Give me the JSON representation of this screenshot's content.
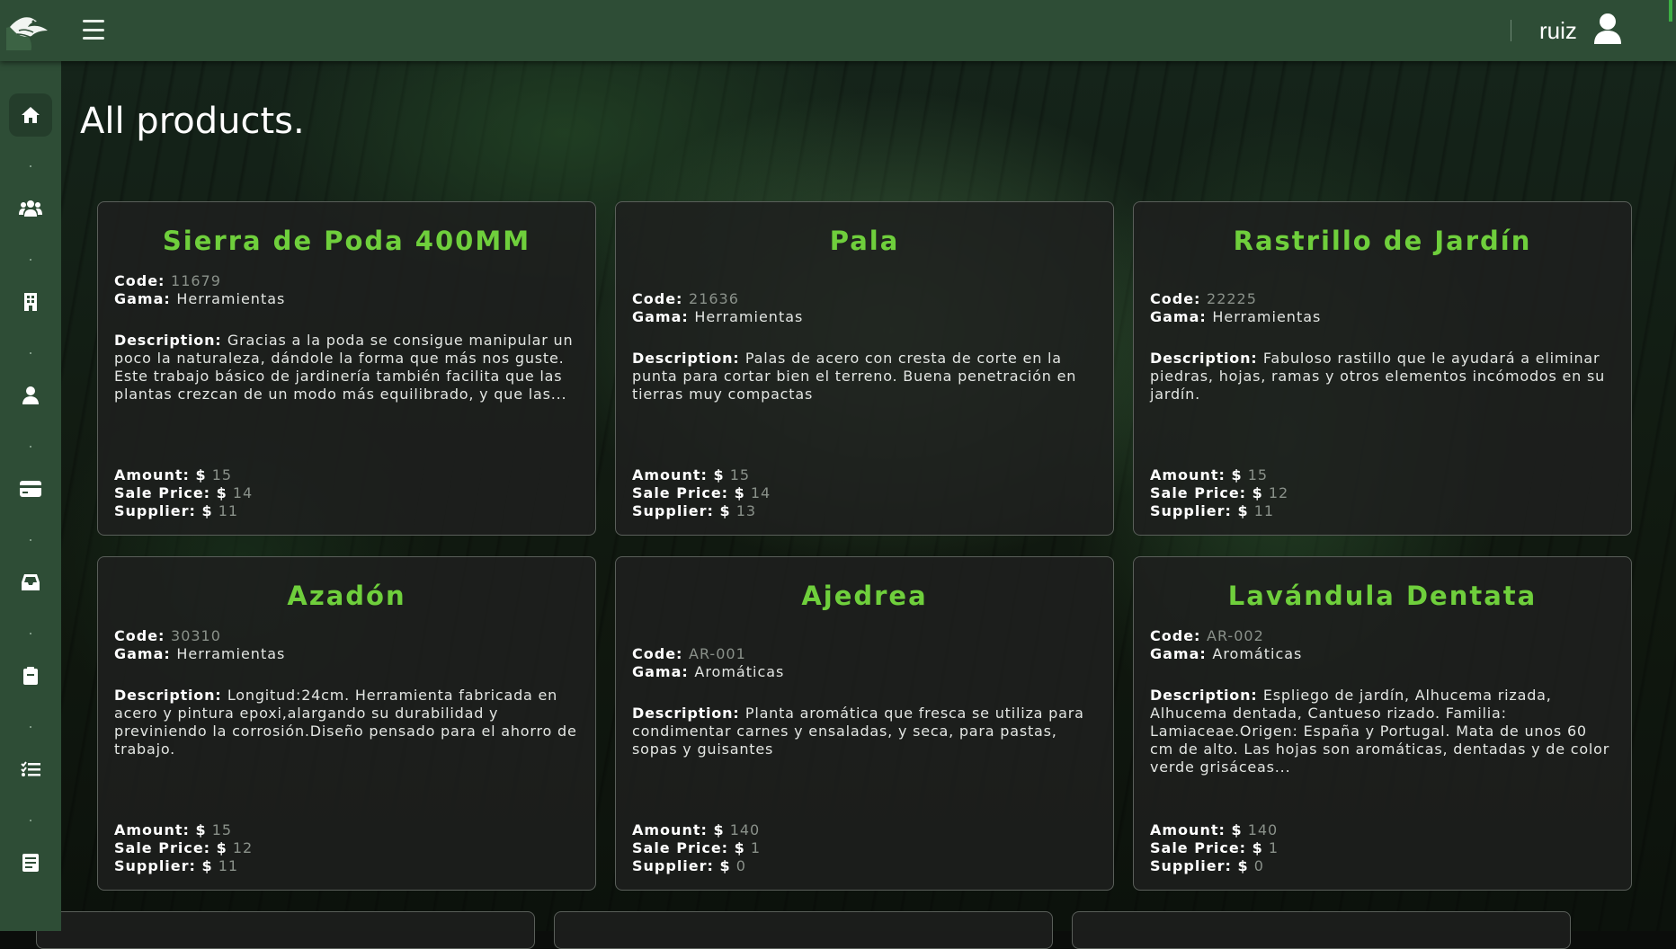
{
  "header": {
    "menu_label": "",
    "user_name": "ruiz"
  },
  "sidebar": {
    "items": [
      {
        "icon": "home-icon",
        "active": true
      },
      {
        "icon": "users-icon",
        "active": false
      },
      {
        "icon": "building-icon",
        "active": false
      },
      {
        "icon": "user-icon",
        "active": false
      },
      {
        "icon": "credit-card-icon",
        "active": false
      },
      {
        "icon": "inbox-icon",
        "active": false
      },
      {
        "icon": "clipboard-icon",
        "active": false
      },
      {
        "icon": "tasks-list-icon",
        "active": false
      },
      {
        "icon": "document-icon",
        "active": false
      }
    ]
  },
  "page": {
    "title": "All products."
  },
  "labels": {
    "code": "Code",
    "gama": "Gama",
    "description": "Description",
    "amount": "Amount",
    "sale_price": "Sale Price",
    "supplier": "Supplier",
    "currency": "$"
  },
  "products": [
    {
      "name": "Sierra de Poda 400MM",
      "code": "11679",
      "gama": "Herramientas",
      "description": "Gracias a la poda se consigue manipular un poco la naturaleza, dándole la forma que más nos guste. Este trabajo básico de jardinería también facilita que las plantas crezcan de un modo más equilibrado, y que las...",
      "amount": "15",
      "sale_price": "14",
      "supplier": "11"
    },
    {
      "name": "Pala",
      "code": "21636",
      "gama": "Herramientas",
      "description": "Palas de acero con cresta de corte en la punta para cortar bien el terreno. Buena penetración en tierras muy compactas",
      "amount": "15",
      "sale_price": "14",
      "supplier": "13"
    },
    {
      "name": "Rastrillo de Jardín",
      "code": "22225",
      "gama": "Herramientas",
      "description": "Fabuloso rastillo que le ayudará a eliminar piedras, hojas, ramas y otros elementos incómodos en su jardín.",
      "amount": "15",
      "sale_price": "12",
      "supplier": "11"
    },
    {
      "name": "Azadón",
      "code": "30310",
      "gama": "Herramientas",
      "description": "Longitud:24cm. Herramienta fabricada en acero y pintura epoxi,alargando su durabilidad y previniendo la corrosión.Diseño pensado para el ahorro de trabajo.",
      "amount": "15",
      "sale_price": "12",
      "supplier": "11"
    },
    {
      "name": "Ajedrea",
      "code": "AR-001",
      "gama": "Aromáticas",
      "description": "Planta aromática que fresca se utiliza para condimentar carnes y ensaladas, y seca, para pastas, sopas y guisantes",
      "amount": "140",
      "sale_price": "1",
      "supplier": "0"
    },
    {
      "name": "Lavándula Dentata",
      "code": "AR-002",
      "gama": "Aromáticas",
      "description": "Espliego de jardín, Alhucema rizada, Alhucema dentada, Cantueso rizado. Familia: Lamiaceae.Origen: España y Portugal. Mata de unos 60 cm de alto. Las hojas son aromáticas, dentadas y de color verde grisáceas...",
      "amount": "140",
      "sale_price": "1",
      "supplier": "0"
    }
  ],
  "colors": {
    "topbar": "#2e4d36",
    "product_title": "#6fcf3c",
    "card_bg": "#1e201e"
  }
}
